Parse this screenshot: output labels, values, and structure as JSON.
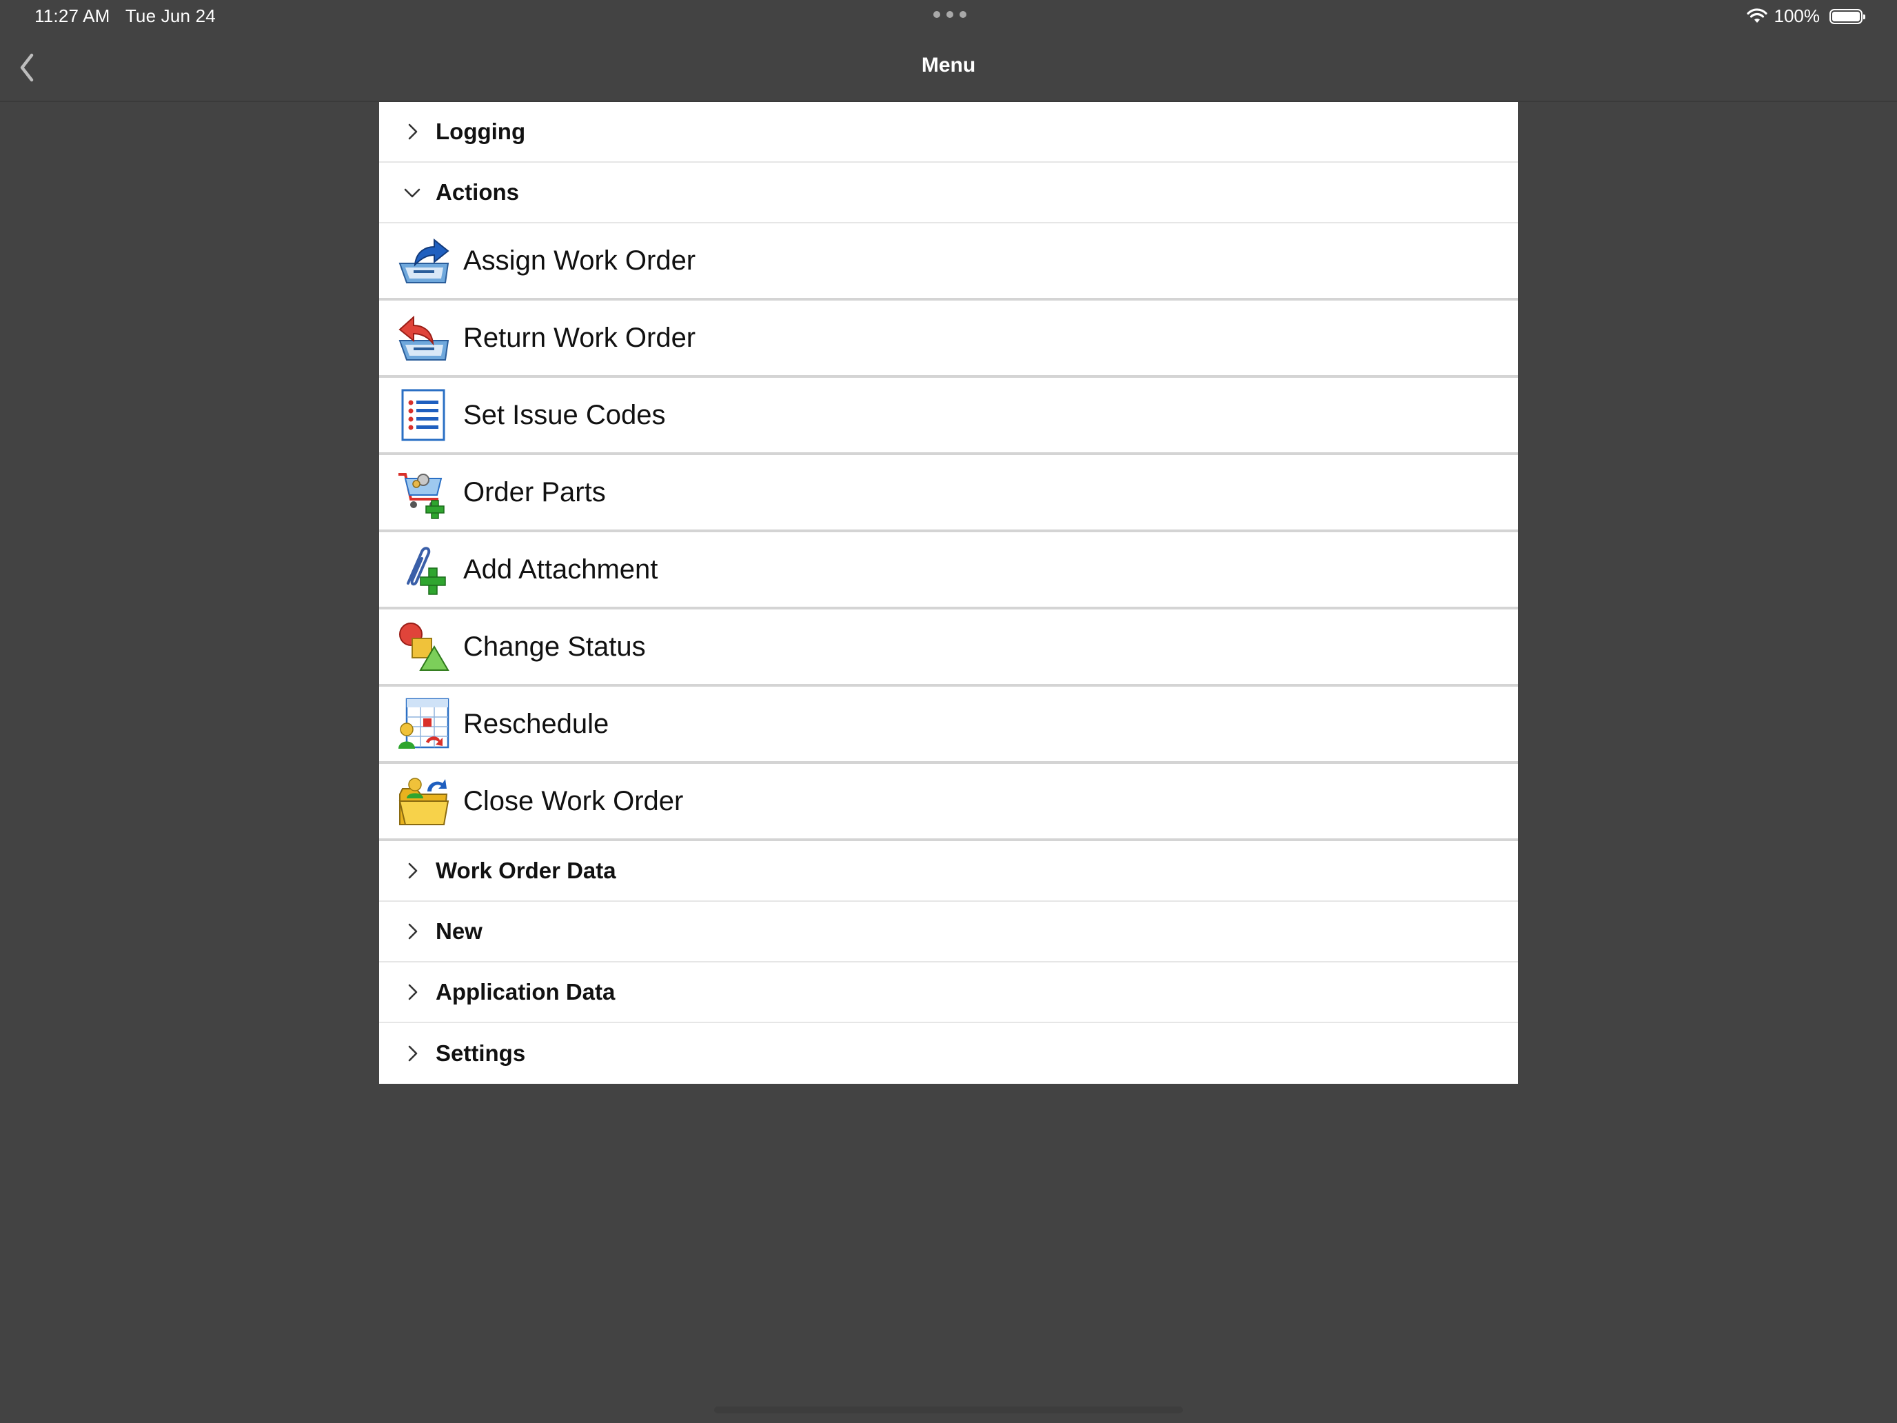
{
  "status_bar": {
    "time": "11:27 AM",
    "date": "Tue Jun 24",
    "battery_percent": "100%",
    "battery_level": 1.0
  },
  "nav": {
    "title": "Menu"
  },
  "sections_top": [
    {
      "label": "Logging",
      "expanded": false
    },
    {
      "label": "Actions",
      "expanded": true
    }
  ],
  "actions": [
    {
      "label": "Assign Work Order",
      "icon": "assign-work-order-icon"
    },
    {
      "label": "Return Work Order",
      "icon": "return-work-order-icon"
    },
    {
      "label": "Set Issue Codes",
      "icon": "issue-codes-list-icon"
    },
    {
      "label": "Order Parts",
      "icon": "order-parts-cart-icon"
    },
    {
      "label": "Add Attachment",
      "icon": "paperclip-add-icon"
    },
    {
      "label": "Change Status",
      "icon": "shapes-status-icon"
    },
    {
      "label": "Reschedule",
      "icon": "calendar-reschedule-icon"
    },
    {
      "label": "Close Work Order",
      "icon": "folder-close-icon"
    }
  ],
  "sections_bottom": [
    {
      "label": "Work Order Data",
      "expanded": false
    },
    {
      "label": "New",
      "expanded": false
    },
    {
      "label": "Application Data",
      "expanded": false
    },
    {
      "label": "Settings",
      "expanded": false
    }
  ],
  "colors": {
    "background": "#434343",
    "panel": "#ffffff",
    "text": "#111111"
  }
}
